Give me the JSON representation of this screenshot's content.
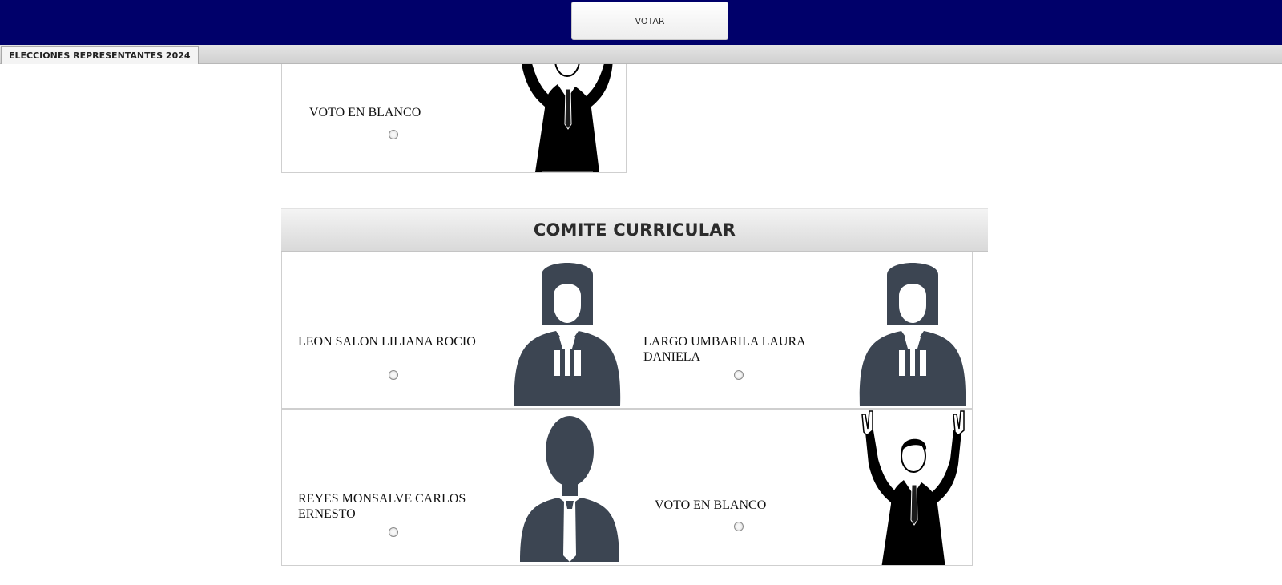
{
  "header": {
    "vote_button_label": "VOTAR"
  },
  "tabs": [
    {
      "label": "ELECCIONES REPRESENTANTES 2024",
      "active": true
    }
  ],
  "previous_section": {
    "cards": [
      {
        "name": "VOTO EN BLANCO",
        "photo": "hands-up-man-icon"
      }
    ]
  },
  "section": {
    "title": "COMITE CURRICULAR",
    "cards": [
      {
        "name": "LEON SALON LILIANA ROCIO",
        "photo": "woman-avatar-icon"
      },
      {
        "name": "LARGO UMBARILA LAURA DANIELA",
        "photo": "woman-avatar-icon"
      },
      {
        "name": "REYES MONSALVE CARLOS ERNESTO",
        "photo": "man-avatar-icon"
      },
      {
        "name": "VOTO EN BLANCO",
        "photo": "hands-up-man-icon"
      }
    ]
  },
  "colors": {
    "header_bg": "#00006a",
    "avatar": "#3c4552"
  }
}
